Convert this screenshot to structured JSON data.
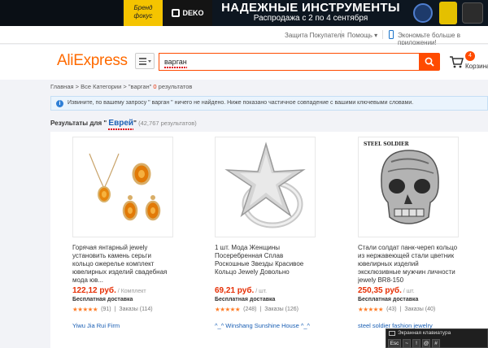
{
  "banner": {
    "brand_line1": "Бренд",
    "brand_line2": "фокус",
    "deko": "DEKO",
    "title": "НАДЕЖНЫЕ ИНСТРУМЕНТЫ",
    "subtitle": "Распродажа с 2 по 4 сентября"
  },
  "topbar": {
    "buyer_protection": "Защита Покупателя",
    "help": "Помощь",
    "app_promo": "Экономьте больше в приложении!"
  },
  "header": {
    "logo_ali": "Ali",
    "logo_express": "Express",
    "search_value": "варган",
    "cart_count": "4",
    "cart_label": "Корзина"
  },
  "breadcrumb": {
    "home": "Главная",
    "sep1": " > ",
    "all": "Все Категории",
    "sep2": " > ",
    "query": "\"варган\"",
    "zero": " 0",
    "results": " результатов"
  },
  "notice": {
    "text": "Извините, по вашему запросу \" варган \" ничего не найдено. Ниже показано частичное совпадение с вашими ключевыми словами."
  },
  "results": {
    "prefix": "Результаты для ",
    "quote_open": "\" ",
    "keyword": "Еврей",
    "quote_close": "\"",
    "count": "(42,767 результатов)"
  },
  "products": [
    {
      "title": "Горячая янтарный jewely установить камень серьги кольцо ожерелье комплект ювелирных изделий свадебная мода юв...",
      "price": "122,12 руб.",
      "unit": " / Комплект",
      "shipping": "Бесплатная доставка",
      "stars": "★★★★★",
      "reviews": "(91)",
      "orders": "Заказы (114)",
      "store": "Yiwu Jia Rui Firm"
    },
    {
      "title": "1 шт. Мода Женщины Посеребренная Сплав Роскошные Звезды Красивое Кольцо Jewely Довольно",
      "price": "69,21 руб.",
      "unit": " / шт.",
      "shipping": "Бесплатная доставка",
      "stars": "★★★★★",
      "reviews": "(248)",
      "orders": "Заказы (126)",
      "store": "^_^ Winshang Sunshine House ^_^"
    },
    {
      "title": "Стали солдат панк-череп кольцо из нержавеющей стали цветник ювелирных изделий эксклюзивные мужчин личности jewely BR8-150",
      "price": "250,35 руб.",
      "unit": " / шт.",
      "shipping": "Бесплатная доставка",
      "stars": "★★★★★",
      "reviews": "(43)",
      "orders": "Заказы (40)",
      "store": "steel soldier fashion jewelry"
    }
  ],
  "product3_brand": "STEEL SOLDIER",
  "keyboard": {
    "title": "Экранная клавиатура",
    "keys": [
      "Esc",
      "~",
      "!",
      "@",
      "#"
    ]
  },
  "colors": {
    "accent": "#ff4b00",
    "price": "#e62e04",
    "link": "#1a5fb4"
  }
}
